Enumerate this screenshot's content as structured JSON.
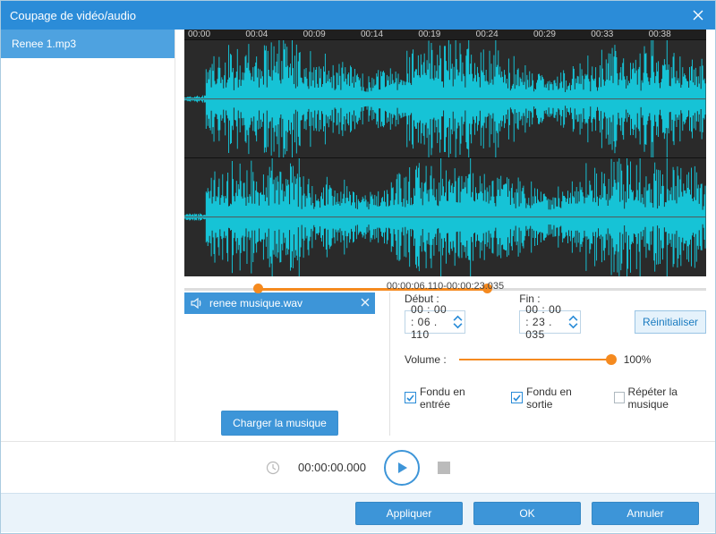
{
  "window": {
    "title": "Coupage de vidéo/audio"
  },
  "sidebar": {
    "items": [
      {
        "label": "Renee 1.mp3"
      }
    ]
  },
  "ruler": {
    "ticks": [
      "00:00",
      "00:04",
      "00:09",
      "00:14",
      "00:19",
      "00:24",
      "00:29",
      "00:33",
      "00:38"
    ]
  },
  "range": {
    "label": "00:00:06.110-00:00:23.035",
    "start_pct": 14,
    "end_pct": 58
  },
  "music_chip": {
    "file": "renee musique.wav"
  },
  "time": {
    "start_label": "Début :",
    "end_label": "Fin :",
    "start_value": "00 : 00 : 06 . 110",
    "end_value": "00 : 00 : 23 . 035",
    "reset": "Réinitialiser"
  },
  "volume": {
    "label": "Volume :",
    "value": "100%",
    "pct": 100
  },
  "checks": {
    "fade_in": {
      "label": "Fondu en entrée",
      "checked": true
    },
    "fade_out": {
      "label": "Fondu en sortie",
      "checked": true
    },
    "repeat": {
      "label": "Répéter la musique",
      "checked": false
    }
  },
  "load_music": "Charger la musique",
  "transport": {
    "time": "00:00:00.000"
  },
  "buttons": {
    "apply": "Appliquer",
    "ok": "OK",
    "cancel": "Annuler"
  }
}
